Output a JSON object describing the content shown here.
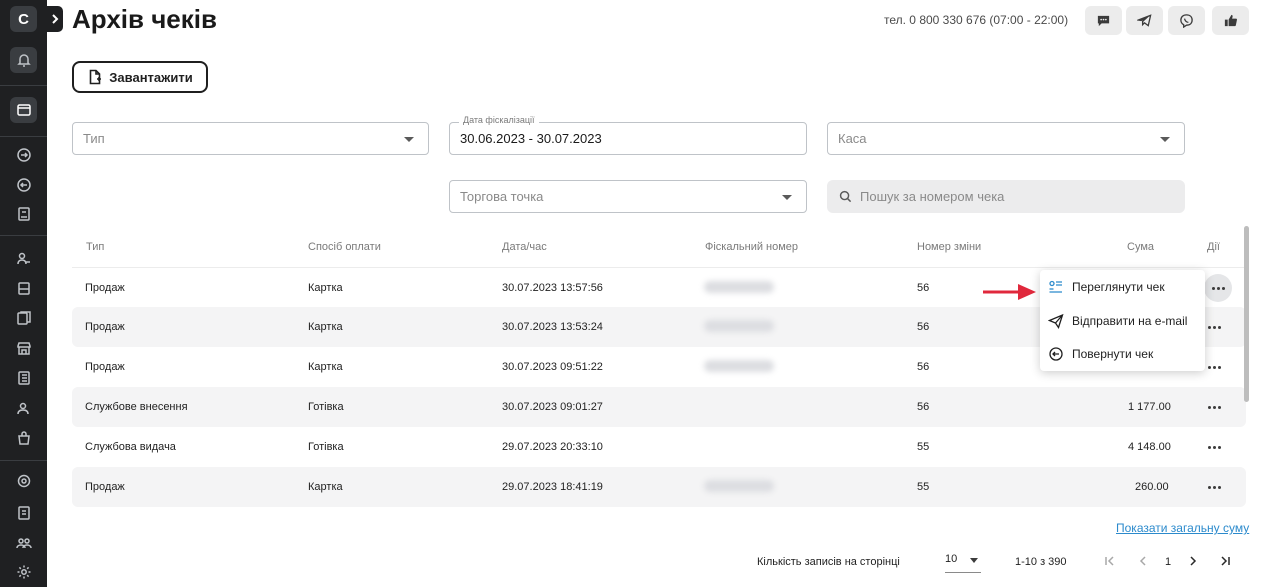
{
  "page": {
    "title": "Архів чеків",
    "phone": "тел. 0 800 330 676 (07:00 - 22:00)"
  },
  "sidebar": {
    "logo": "С",
    "icons": [
      "bell-icon",
      "receipt-icon",
      "login-icon",
      "return-icon",
      "report-icon",
      "users-icon",
      "register-icon",
      "documents-icon",
      "store-icon",
      "list-icon",
      "person-icon",
      "bag-icon",
      "settings-cog-icon",
      "book-icon",
      "team-icon",
      "gear-icon"
    ]
  },
  "header_icons": [
    "chat-icon",
    "telegram-icon",
    "viber-icon",
    "thumbs-up-icon"
  ],
  "toolbar": {
    "download_label": "Завантажити"
  },
  "filters": {
    "type_placeholder": "Тип",
    "date_label": "Дата фіскалізації",
    "date_value": "30.06.2023 - 30.07.2023",
    "register_placeholder": "Каса",
    "store_placeholder": "Торгова точка",
    "search_placeholder": "Пошук за номером чека"
  },
  "table": {
    "headers": [
      "Тип",
      "Спосіб оплати",
      "Дата/час",
      "Фіскальний номер",
      "Номер зміни",
      "Сума",
      "Дії"
    ],
    "rows": [
      {
        "type": "Продаж",
        "payment": "Картка",
        "datetime": "30.07.2023 13:57:56",
        "shift": "56",
        "sum": ""
      },
      {
        "type": "Продаж",
        "payment": "Картка",
        "datetime": "30.07.2023 13:53:24",
        "shift": "56",
        "sum": ""
      },
      {
        "type": "Продаж",
        "payment": "Картка",
        "datetime": "30.07.2023 09:51:22",
        "shift": "56",
        "sum": ""
      },
      {
        "type": "Службове внесення",
        "payment": "Готівка",
        "datetime": "30.07.2023 09:01:27",
        "shift": "56",
        "sum": "1 177.00"
      },
      {
        "type": "Службова видача",
        "payment": "Готівка",
        "datetime": "29.07.2023 20:33:10",
        "shift": "55",
        "sum": "4 148.00"
      },
      {
        "type": "Продаж",
        "payment": "Картка",
        "datetime": "29.07.2023 18:41:19",
        "shift": "55",
        "sum": "260.00"
      }
    ]
  },
  "context_menu": {
    "view": "Переглянути чек",
    "email": "Відправити на e-mail",
    "return": "Повернути чек"
  },
  "footer": {
    "total_link": "Показати загальну суму",
    "per_page_label": "Кількість записів на сторінці",
    "per_page_value": "10",
    "range": "1-10 з 390",
    "current_page": "1"
  },
  "colors": {
    "sidebar": "#1f2022",
    "link": "#2b8acc",
    "arrow": "#e0283c",
    "menu_icon_accent": "#2b8acc"
  }
}
